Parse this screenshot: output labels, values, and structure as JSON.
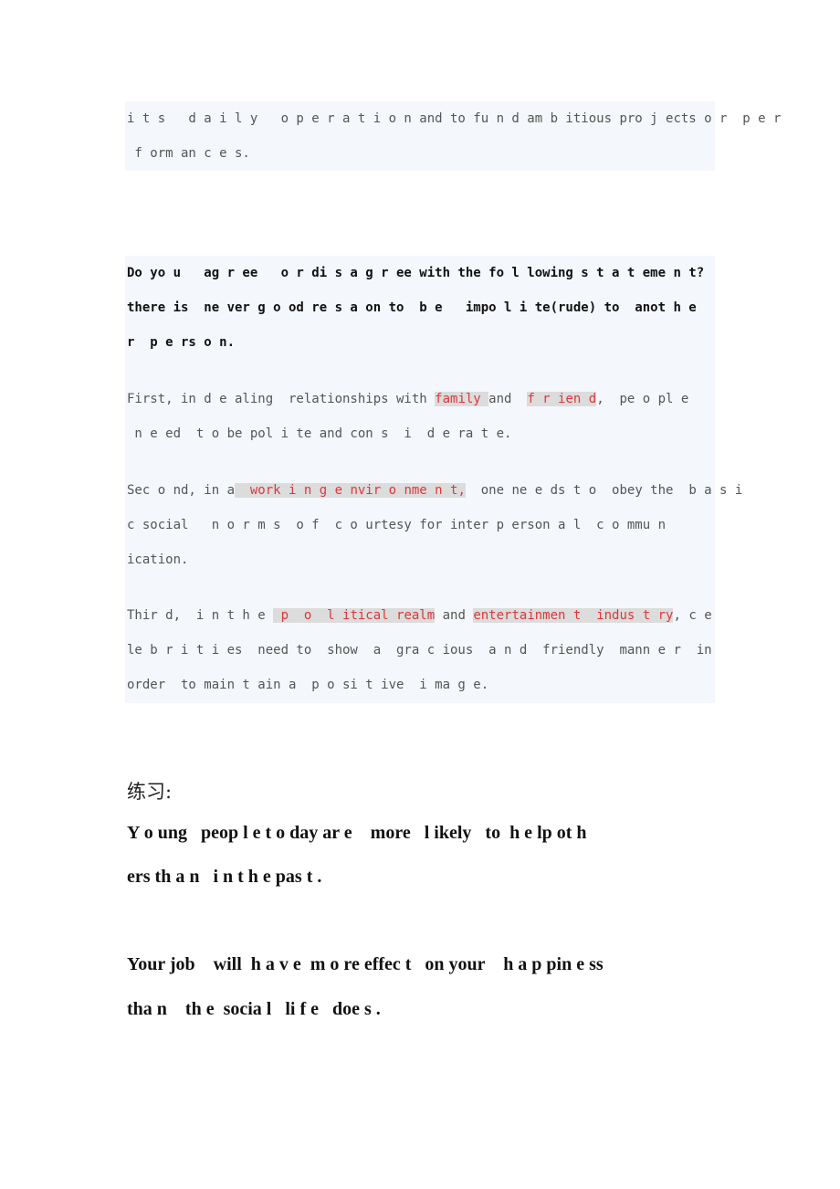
{
  "intro": {
    "lines": [
      "i t s   d a i l y   o p e r a t i o n and to fu n d am b itious pro j ects o r  p e r",
      " f orm an c e s."
    ]
  },
  "question": {
    "lines": [
      "Do yo u   ag r ee   o r di s a g r ee with the fo l lowing s t a t eme n t?",
      "there is  ne ver g o od re s a on to  b e   impo l i te(rude) to  anot h e",
      "r  p e rs o n."
    ]
  },
  "points": {
    "first": {
      "l1_a": "First, in d e aling  relationships with ",
      "l1_h1": "family ",
      "l1_b": "and  ",
      "l1_h2": "f r ien d",
      "l1_c": ",  pe o pl e",
      "l2": " n e ed  t o be pol i te and con s  i  d e ra t e."
    },
    "second": {
      "l1_a": "Sec o nd, in a",
      "l1_h": "  work i n g e nvir o nme n t,",
      "l1_b": "  one ne e ds t o  obey the  b a s i",
      "l2": "c social   n o r m s  o f  c o urtesy for inter p erson a l  c o mmu n",
      "l3": "ication."
    },
    "third": {
      "l1_a": "Thir d,  i n t h e ",
      "l1_h1": " p  o  l itical realm",
      "l1_b": " and ",
      "l1_h2": "entertainmen t  indus t ry",
      "l1_c": ", c e",
      "l2": "le b r i t i es  need to  show  a  gra c ious  a n d  friendly  mann e r  in",
      "l3": "order  to main t ain a  p o si t ive  i ma g e."
    }
  },
  "practice": {
    "heading": "练习:",
    "s1": [
      "Y o ung   peop l e t o day ar e    more   l ikely   to  h e lp ot h",
      "ers th a n   i n t h e pas t ."
    ],
    "s2": [
      "Your job    will  h a v e  m o re effec t   on your    h a p pin e ss",
      "tha n    th e  socia l   li f e   doe s ."
    ]
  },
  "colors": {
    "highlight_text": "#e0363a",
    "highlight_bg": "#dcdcdc",
    "box_bg": "#f4f7fb"
  }
}
